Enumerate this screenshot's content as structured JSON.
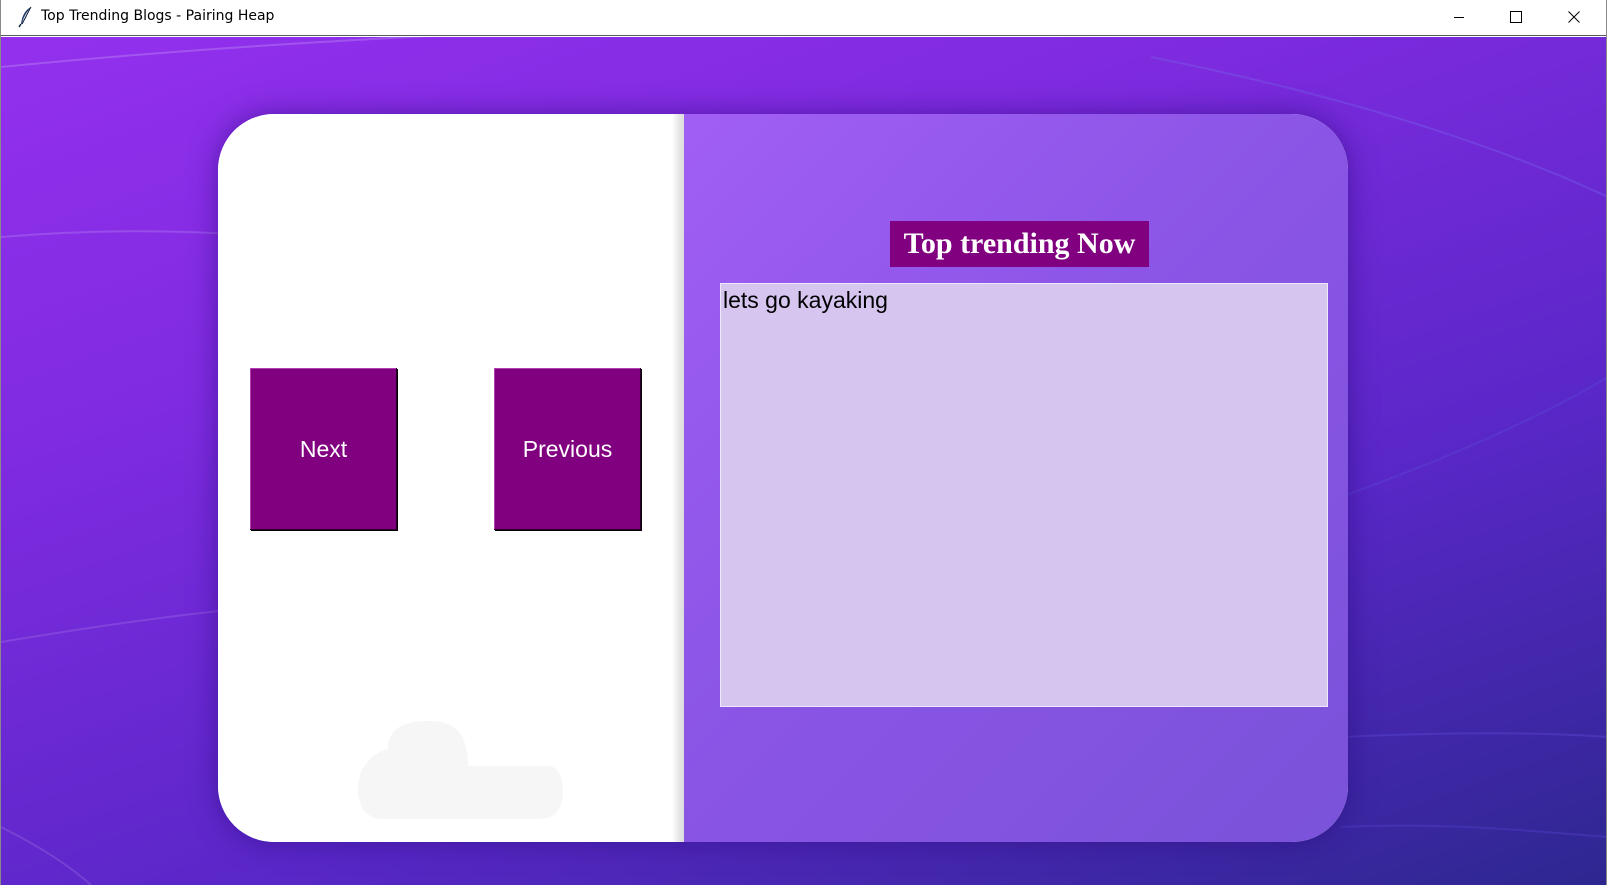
{
  "window": {
    "title": "Top Trending Blogs - Pairing Heap",
    "app_icon": "feather-icon",
    "controls": [
      "minimize-icon",
      "maximize-icon",
      "close-icon"
    ]
  },
  "navigation": {
    "next_label": "Next",
    "previous_label": "Previous"
  },
  "trending": {
    "heading": "Top trending Now",
    "blog_text": "lets go kayaking"
  },
  "colors": {
    "button_bg": "#800080",
    "heading_bg": "#800080",
    "text_box_bg": "#d5c5ef",
    "panel_purple": "#9a5cf0",
    "background_purple": "#7f2be0"
  }
}
